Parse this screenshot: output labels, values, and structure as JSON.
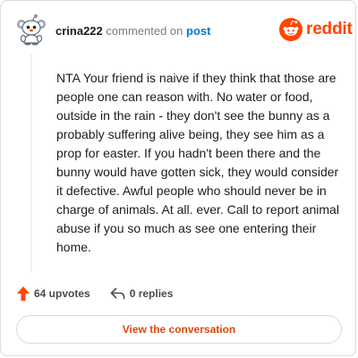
{
  "header": {
    "username": "crina222",
    "action_text": "commented on",
    "post_link": "post",
    "brand_wordmark": "reddit",
    "brand_color": "#ff4500",
    "link_color": "#0079d3"
  },
  "comment": {
    "body": "NTA Your friend is naive if they think that those are people one can reason with. No water or food, outside in the rain - they don't see the bunny as a probably suffering alive being, they see him as a prop for easter. If you hadn't been there and the bunny would have gotten sick, they would consider it defective. Awful people who should never be in charge of animals. At all. ever. Call to report animal abuse if you so much as see one entering their home."
  },
  "actions": {
    "upvotes_label": "64 upvotes",
    "upvote_icon": "upvote-arrow-icon",
    "upvote_color": "#ff4500",
    "replies_label": "0 replies",
    "reply_icon": "reply-arrow-icon"
  },
  "button": {
    "label": "View the conversation",
    "color": "#e0460a"
  }
}
